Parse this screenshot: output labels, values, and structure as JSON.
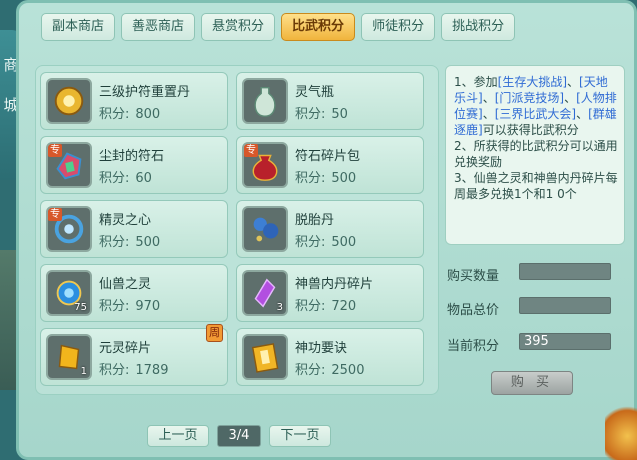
{
  "side": {
    "label": "商 城"
  },
  "tabs": [
    {
      "label": "副本商店"
    },
    {
      "label": "善恶商店"
    },
    {
      "label": "悬赏积分"
    },
    {
      "label": "比武积分",
      "active": true
    },
    {
      "label": "师徒积分"
    },
    {
      "label": "挑战积分"
    }
  ],
  "price_label": "积分:",
  "items": [
    {
      "name": "三级护符重置丹",
      "price": "800",
      "icon": "gold-amulet-icon"
    },
    {
      "name": "灵气瓶",
      "price": "50",
      "icon": "jade-vase-icon"
    },
    {
      "name": "尘封的符石",
      "price": "60",
      "icon": "rune-stone-icon",
      "badge": "专"
    },
    {
      "name": "符石碎片包",
      "price": "500",
      "icon": "red-bag-icon",
      "badge": "专"
    },
    {
      "name": "精灵之心",
      "price": "500",
      "icon": "spirit-heart-icon",
      "badge": "专"
    },
    {
      "name": "脱胎丹",
      "price": "500",
      "icon": "pill-icon"
    },
    {
      "name": "仙兽之灵",
      "price": "970",
      "icon": "beast-spirit-icon",
      "count": "75"
    },
    {
      "name": "神兽内丹碎片",
      "price": "720",
      "icon": "purple-crystal-icon",
      "count": "3"
    },
    {
      "name": "元灵碎片",
      "price": "1789",
      "icon": "gold-shard-icon",
      "count": "1",
      "weekly": "周"
    },
    {
      "name": "神功要诀",
      "price": "2500",
      "icon": "manual-book-icon"
    }
  ],
  "info": {
    "p1": "1、参加",
    "link1": "[生存大挑战]",
    "sep1": "、",
    "link2": "[天地乐斗]",
    "sep2": "、",
    "link3": "[门派竞技场]",
    "sep3": "、",
    "link4": "[人物排位赛]",
    "sep4": "、",
    "link5": "[三界比武大会]",
    "sep5": "、",
    "link6": "[群雄逐鹿]",
    "p1_end": "可以获得比武积分",
    "p2": "2、所获得的比武积分可以通用兑换奖励",
    "p3": "3、仙兽之灵和神兽内丹碎片每周最多兑换1个和1 0个"
  },
  "form": {
    "qty_label": "购买数量",
    "qty_value": "",
    "total_label": "物品总价",
    "total_value": "",
    "current_label": "当前积分",
    "current_value": "395"
  },
  "buy_label": "购 买",
  "pagination": {
    "prev": "上一页",
    "page": "3/4",
    "next": "下一页"
  }
}
